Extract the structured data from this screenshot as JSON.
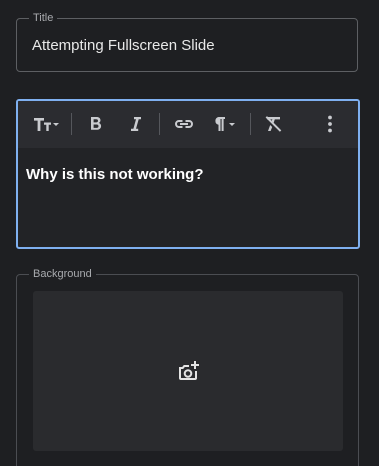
{
  "title_field": {
    "label": "Title",
    "value": "Attempting Fullscreen Slide"
  },
  "editor": {
    "toolbar": {
      "text_size": "text-size-icon",
      "bold": "bold-icon",
      "italic": "italic-icon",
      "link": "link-icon",
      "paragraph": "paragraph-icon",
      "clear_format": "clear-format-icon",
      "more": "more-vertical-icon"
    },
    "content": "Why is this not working?",
    "accent_color": "#7fb0f0"
  },
  "background_field": {
    "label": "Background",
    "upload_icon": "add-photo-icon"
  }
}
